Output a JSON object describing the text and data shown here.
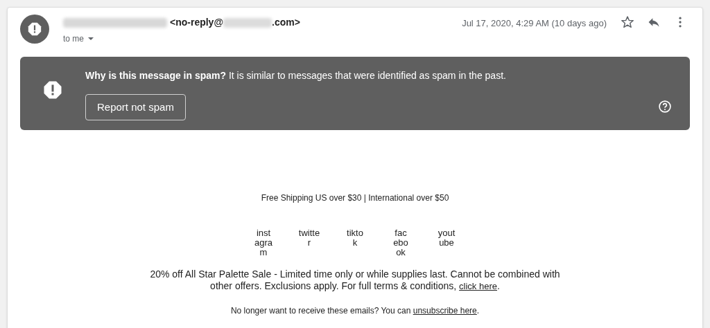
{
  "header": {
    "address_start": "<no-reply@",
    "address_end": ".com>",
    "recipient": "to me",
    "date": "Jul 17, 2020, 4:29 AM (10 days ago)"
  },
  "spam_banner": {
    "question": "Why is this message in spam?",
    "explanation": "It is similar to messages that were identified as spam in the past.",
    "button": "Report not spam"
  },
  "body": {
    "shipping": "Free Shipping US over $30 | International over $50",
    "social_links": [
      {
        "lines": [
          "inst",
          "agra",
          "m"
        ]
      },
      {
        "lines": [
          "twitte",
          "r"
        ]
      },
      {
        "lines": [
          "tikto",
          "k"
        ]
      },
      {
        "lines": [
          "fac",
          "ebo",
          "ok"
        ]
      },
      {
        "lines": [
          "yout",
          "ube"
        ]
      }
    ],
    "sale_text": "20% off All Star Palette Sale - Limited time only or while supplies last. Cannot be combined with other offers. Exclusions apply. For full terms & conditions,",
    "sale_link": "click here",
    "sale_end": ".",
    "unsubscribe_text": "No longer want to receive these emails? You can",
    "unsubscribe_link": "unsubscribe here",
    "unsubscribe_end": "."
  }
}
